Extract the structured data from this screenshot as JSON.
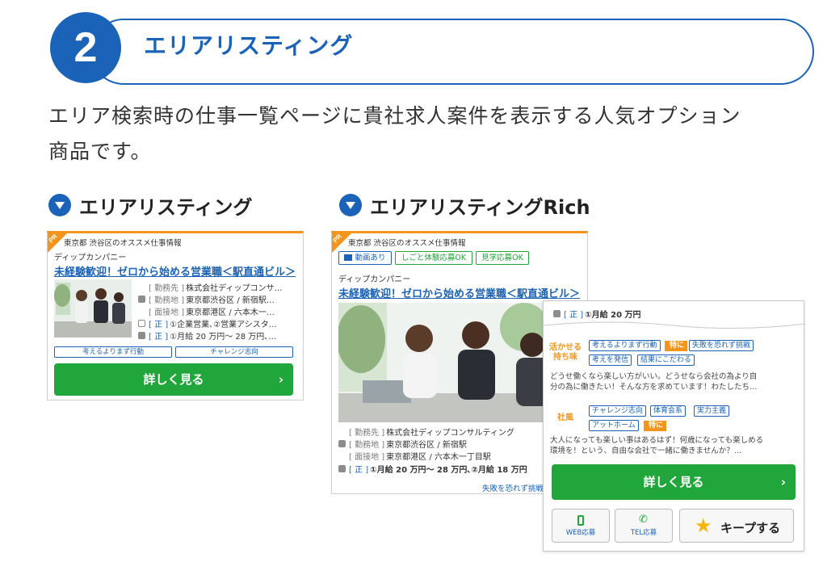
{
  "section": {
    "number": "2",
    "title": "エリアリスティング",
    "description_lines": [
      "エリア検索時の仕事一覧ページに貴社求人案件を表示する人気オプション",
      "商品です。"
    ]
  },
  "variants": {
    "standard": {
      "heading": "エリアリスティング"
    },
    "rich": {
      "heading": "エリアリスティングRich"
    }
  },
  "card": {
    "pr_label": "PR",
    "area": "東京都 渋谷区のオススメ仕事情報",
    "company": "ディップカンパニー",
    "job_title": "未経験歓迎！ゼロから始める営業職＜駅直通ビル＞",
    "cta_label": "詳しく見る",
    "cta_chevron": "›"
  },
  "standard_card": {
    "rows": [
      {
        "key": "[ 勤務先 ]",
        "value": "株式会社ディップコンサ…"
      },
      {
        "key": "[ 勤務地 ]",
        "value": "東京都渋谷区 / 新宿駅…"
      },
      {
        "key": "[ 面接地 ]",
        "value": "東京都港区 / 六本木一…"
      },
      {
        "key": "[ 正 ]",
        "value": "①企業営業､②営業アシスタ…"
      },
      {
        "key": "[ 正 ]",
        "value": "①月給 20 万円〜 28 万円､…"
      }
    ],
    "tags": [
      "考えるよりまず行動",
      "チャレンジ志向"
    ]
  },
  "rich_card": {
    "top_buttons": [
      "動画あり",
      "しごと体験応募OK",
      "見学応募OK"
    ],
    "rows": [
      {
        "key": "[ 勤務先 ]",
        "value": "株式会社ディップコンサルティング"
      },
      {
        "key": "[ 勤務地 ]",
        "value": "東京都渋谷区 / 新宿駅"
      },
      {
        "key": "[ 面接地 ]",
        "value": "東京都港区 / 六本木一丁目駅"
      },
      {
        "key": "[ 正 ]",
        "value": "①月給 20 万円〜 28 万円､②月給 18 万円"
      }
    ],
    "peek_salary_key": "[ 正 ]",
    "peek_salary_value": "①月給 20 万円",
    "peek_bottom_text": "失敗を恐れず挑戦"
  },
  "popup": {
    "feature1": {
      "label_line1": "活かせる",
      "label_line2": "持ち味",
      "tags_row1": [
        "考えるよりまず行動",
        "失敗を恐れず挑戦"
      ],
      "tags_row2": [
        "考えを発信",
        "結果にこだわる"
      ],
      "special": "特に",
      "text_line1": "どうせ働くなら楽しい方がいい。どうせなら会社の為より自",
      "text_line2": "分の為に働きたい！そんな方を求めています！わたしたち…"
    },
    "feature2": {
      "label": "社風",
      "tags_row1": [
        "チャレンジ志向",
        "体育会系",
        "実力主義"
      ],
      "tags_row2": [
        "アットホーム"
      ],
      "special": "特に",
      "text_line1": "大人になっても楽しい事はあるはず！何歳になっても楽しめる",
      "text_line2": "環境を！という、自由な会社で一緒に働きませんか？…"
    },
    "cta_label": "詳しく見る",
    "cta_chevron": "›",
    "web_apply": "WEB応募",
    "tel_apply": "TEL応募",
    "keep": "キープする"
  },
  "colors": {
    "brand_blue": "#1a63b8",
    "accent_orange": "#f3941c",
    "cta_green": "#20a63a"
  },
  "icons": {
    "header_marker": "triangle-down-circle-icon",
    "map_pin": "map-pin-icon",
    "calendar": "calendar-icon",
    "yen": "yen-icon",
    "web": "smartphone-icon",
    "tel": "phone-icon",
    "keep": "star-icon"
  }
}
